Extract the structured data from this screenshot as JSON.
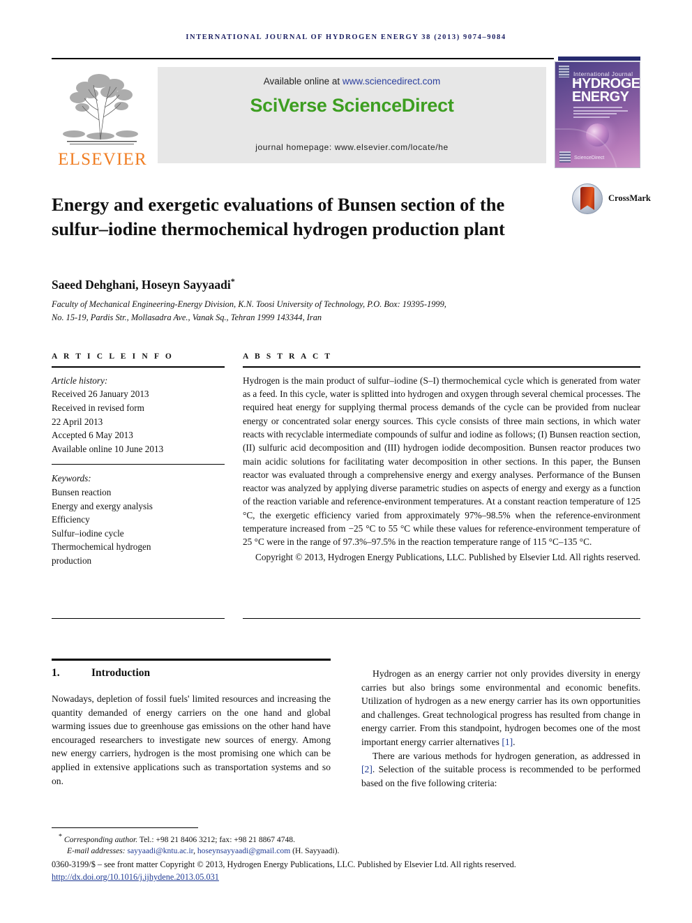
{
  "running_head": "International Journal of Hydrogen Energy 38 (2013) 9074–9084",
  "masthead": {
    "publisher_name": "ELSEVIER",
    "available_prefix": "Available online at ",
    "available_url": "www.sciencedirect.com",
    "platform_logo": "SciVerse ScienceDirect",
    "journal_homepage": "journal homepage: www.elsevier.com/locate/he",
    "cover": {
      "line1": "International Journal of",
      "line2": "HYDROGEN",
      "line3": "ENERGY",
      "sciencedirect_mark": "ScienceDirect"
    }
  },
  "article": {
    "title": "Energy and exergetic evaluations of Bunsen section of the sulfur–iodine thermochemical hydrogen production plant",
    "crossmark_label": "CrossMark",
    "authors": "Saeed Dehghani, Hoseyn Sayyaadi",
    "author_star": "*",
    "affiliation_line1": "Faculty of Mechanical Engineering-Energy Division, K.N. Toosi University of Technology, P.O. Box: 19395-1999,",
    "affiliation_line2": "No. 15-19, Pardis Str., Mollasadra Ave., Vanak Sq., Tehran 1999 143344, Iran"
  },
  "article_info": {
    "heading": "A R T I C L E  I N F O",
    "history_label": "Article history:",
    "history": [
      "Received 26 January 2013",
      "Received in revised form",
      "22 April 2013",
      "Accepted 6 May 2013",
      "Available online 10 June 2013"
    ],
    "keywords_label": "Keywords:",
    "keywords": [
      "Bunsen reaction",
      "Energy and exergy analysis",
      "Efficiency",
      "Sulfur–iodine cycle",
      "Thermochemical hydrogen",
      "production"
    ]
  },
  "abstract": {
    "heading": "A B S T R A C T",
    "text": "Hydrogen is the main product of sulfur–iodine (S–I) thermochemical cycle which is generated from water as a feed. In this cycle, water is splitted into hydrogen and oxygen through several chemical processes. The required heat energy for supplying thermal process demands of the cycle can be provided from nuclear energy or concentrated solar energy sources. This cycle consists of three main sections, in which water reacts with recyclable intermediate compounds of sulfur and iodine as follows; (I) Bunsen reaction section, (II) sulfuric acid decomposition and (III) hydrogen iodide decomposition. Bunsen reactor produces two main acidic solutions for facilitating water decomposition in other sections. In this paper, the Bunsen reactor was evaluated through a comprehensive energy and exergy analyses. Performance of the Bunsen reactor was analyzed by applying diverse parametric studies on aspects of energy and exergy as a function of the reaction variable and reference-environment temperatures. At a constant reaction temperature of 125 °C, the exergetic efficiency varied from approximately 97%–98.5% when the reference-environment temperature increased from −25 °C to 55 °C while these values for reference-environment temperature of 25 °C were in the range of 97.3%–97.5% in the reaction temperature range of 115 °C–135 °C.",
    "copyright": "Copyright © 2013, Hydrogen Energy Publications, LLC. Published by Elsevier Ltd. All rights reserved."
  },
  "introduction": {
    "number": "1.",
    "heading": "Introduction",
    "left_para1": "Nowadays, depletion of fossil fuels' limited resources and increasing the quantity demanded of energy carriers on the one hand and global warming issues due to greenhouse gas emissions on the other hand have encouraged researchers to investigate new sources of energy. Among new energy carriers, hydrogen is the most promising one which can be applied in extensive applications such as transportation systems and so on.",
    "right_para1_a": "Hydrogen as an energy carrier not only provides diversity in energy carries but also brings some environmental and economic benefits. Utilization of hydrogen as a new energy carrier has its own opportunities and challenges. Great technological progress has resulted from change in energy carrier. From this standpoint, hydrogen becomes one of the most important energy carrier alternatives ",
    "right_para1_ref": "[1]",
    "right_para1_b": ".",
    "right_para2_a": "There are various methods for hydrogen generation, as addressed in ",
    "right_para2_ref": "[2]",
    "right_para2_b": ". Selection of the suitable process is recommended to be performed based on the five following criteria:"
  },
  "footnotes": {
    "corresponding_star": "*",
    "corresponding_label": "Corresponding author.",
    "corresponding_rest": " Tel.: +98 21 8406 3212; fax: +98 21 8867 4748.",
    "email_label": "E-mail addresses: ",
    "email1": "sayyaadi@kntu.ac.ir",
    "email_sep": ", ",
    "email2": "hoseynsayyaadi@gmail.com",
    "email_suffix": " (H. Sayyaadi).",
    "issn_line": "0360-3199/$ – see front matter Copyright © 2013, Hydrogen Energy Publications, LLC. Published by Elsevier Ltd. All rights reserved.",
    "doi": "http://dx.doi.org/10.1016/j.ijhydene.2013.05.031"
  },
  "colors": {
    "runhead": "#1b1f62",
    "elsevier_orange": "#f07d22",
    "sciencedirect_green": "#3d9e21",
    "link_blue": "#1f3a93",
    "header_bar": "#262a6e"
  }
}
